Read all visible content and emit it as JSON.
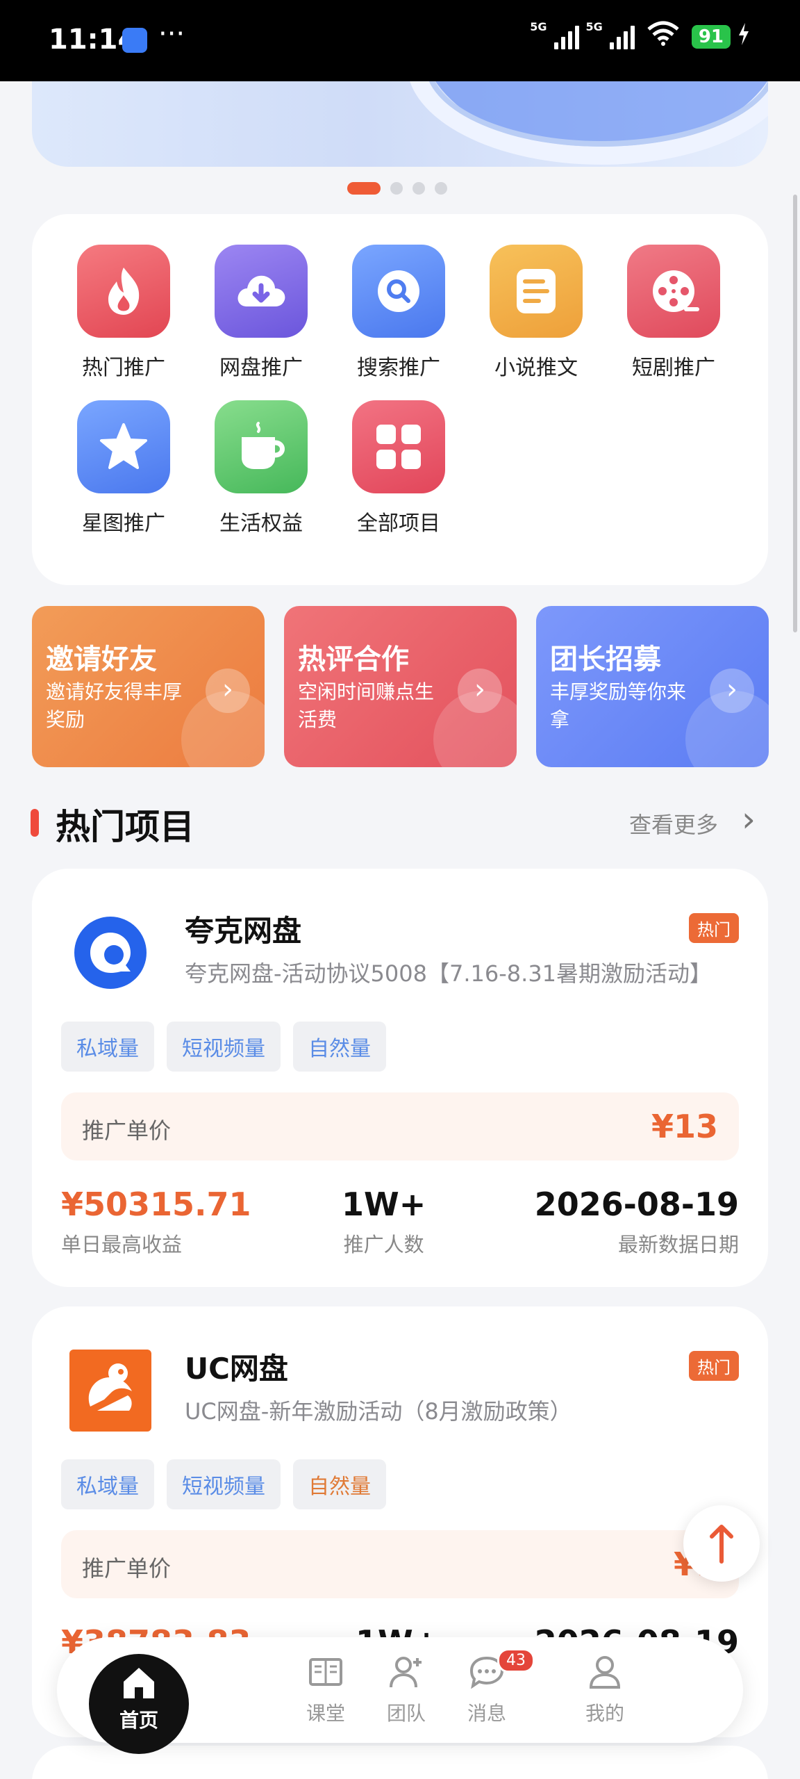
{
  "status_bar": {
    "time": "11:14",
    "dots": "···",
    "net1": "5G",
    "net2": "5G",
    "battery": "91"
  },
  "banner": {
    "pager_total": 4,
    "pager_index": 1
  },
  "categories": [
    {
      "label": "热门推广",
      "icon": "fire-icon"
    },
    {
      "label": "网盘推广",
      "icon": "cloud-download-icon"
    },
    {
      "label": "搜索推广",
      "icon": "search-icon"
    },
    {
      "label": "小说推文",
      "icon": "document-icon"
    },
    {
      "label": "短剧推广",
      "icon": "film-reel-icon"
    },
    {
      "label": "星图推广",
      "icon": "star-icon"
    },
    {
      "label": "生活权益",
      "icon": "coffee-cup-icon"
    },
    {
      "label": "全部项目",
      "icon": "grid-icon"
    }
  ],
  "promos": [
    {
      "title": "邀请好友",
      "desc": "邀请好友得丰厚奖励",
      "color_from": "#f09a55",
      "color_to": "#ec7a3e"
    },
    {
      "title": "热评合作",
      "desc": "空闲时间赚点生活费",
      "color_from": "#f07275",
      "color_to": "#e4505c"
    },
    {
      "title": "团长招募",
      "desc": "丰厚奖励等你来拿",
      "color_from": "#7a96fb",
      "color_to": "#5b7cf3"
    }
  ],
  "section": {
    "title": "热门项目",
    "more": "查看更多"
  },
  "projects": [
    {
      "name": "夸克网盘",
      "subtitle": "夸克网盘-活动协议5008【7.16-8.31暑期激励活动】",
      "badge": "热门",
      "tags": [
        "私域量",
        "短视频量",
        "自然量"
      ],
      "price_label": "推广单价",
      "price": "¥13",
      "stat1_value": "¥50315.71",
      "stat1_label": "单日最高收益",
      "stat2_value": "1W+",
      "stat2_label": "推广人数",
      "stat3_value": "2026-08-19",
      "stat3_label": "最新数据日期"
    },
    {
      "name": "UC网盘",
      "subtitle": "UC网盘-新年激励活动（8月激励政策）",
      "badge": "热门",
      "tags": [
        "私域量",
        "短视频量",
        "自然量"
      ],
      "price_label": "推广单价",
      "price": "¥1",
      "stat1_value": "¥38783.83",
      "stat2_value": "1W+",
      "stat3_value": "2026-08-19"
    }
  ],
  "tabbar": [
    {
      "label": "首页",
      "icon": "home-icon",
      "active": true
    },
    {
      "label": "课堂",
      "icon": "book-icon"
    },
    {
      "label": "团队",
      "icon": "team-icon"
    },
    {
      "label": "消息",
      "icon": "chat-icon",
      "badge": "43"
    },
    {
      "label": "我的",
      "icon": "profile-icon"
    }
  ],
  "colors": {
    "accent": "#ea6533",
    "hot_badge": "#ec6a36",
    "tag_blue": "#5a8ce6",
    "tag_orange": "#e07a36"
  }
}
